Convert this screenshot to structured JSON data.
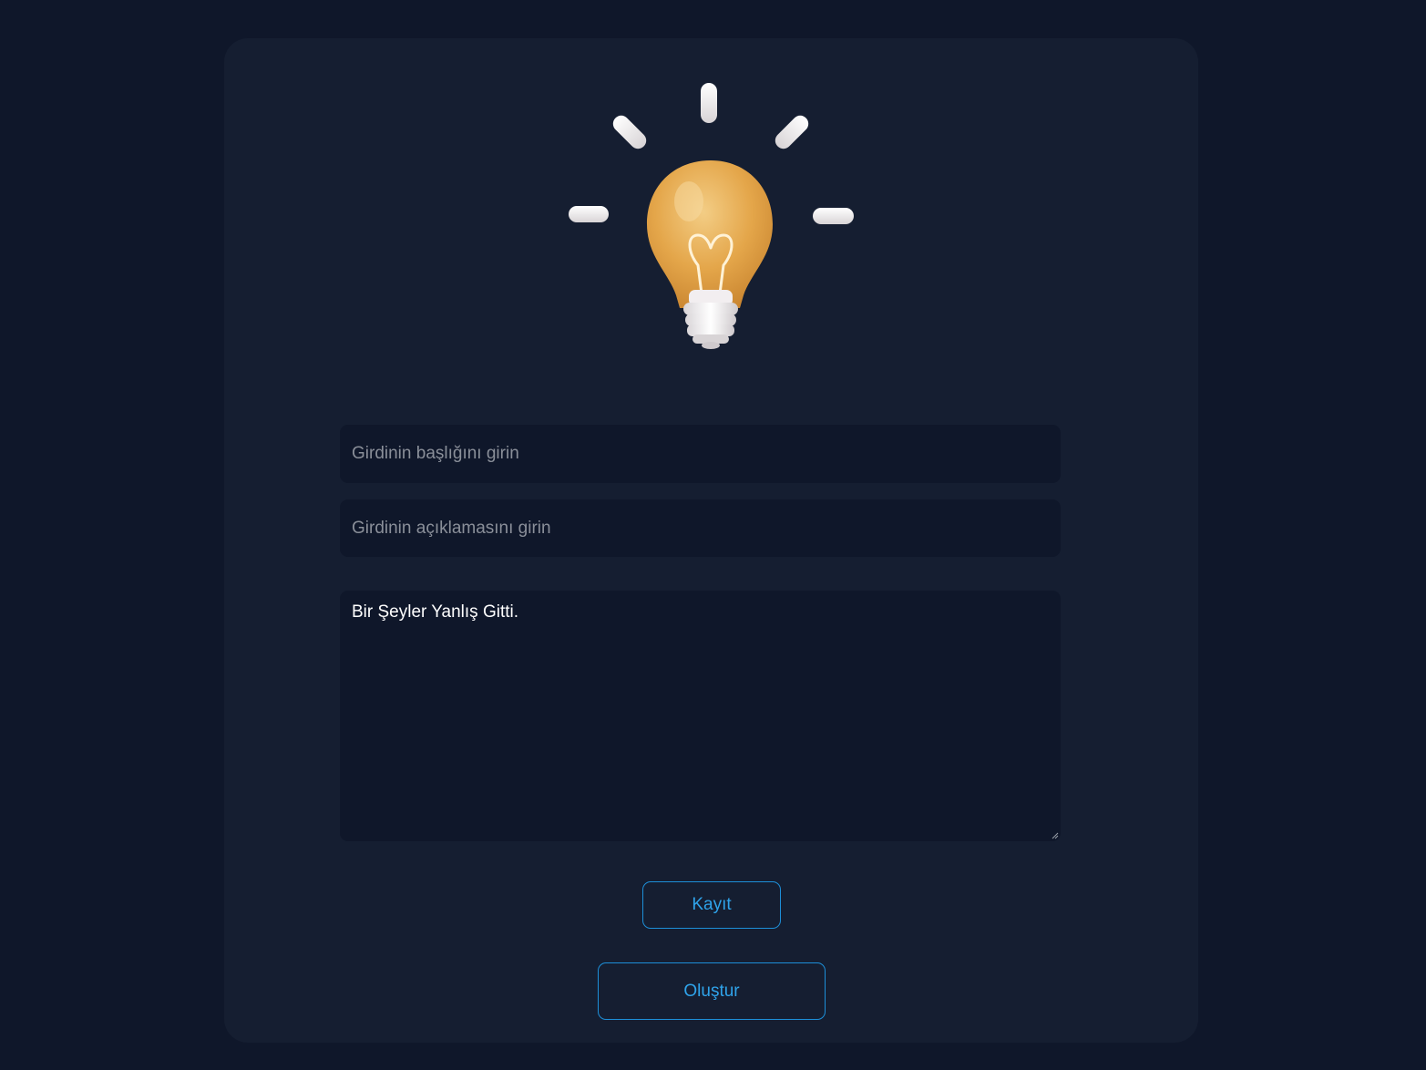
{
  "form": {
    "title_placeholder": "Girdinin başlığını girin",
    "description_placeholder": "Girdinin açıklamasını girin",
    "content_text": "Bir Şeyler Yanlış Gitti."
  },
  "buttons": {
    "save_label": "Kayıt",
    "create_label": "Oluştur"
  },
  "colors": {
    "page_bg": "#0f172a",
    "card_bg": "#151e31",
    "field_bg": "#0f172a",
    "accent": "#1d8fd8",
    "bulb": "#e6a94c"
  },
  "icons": {
    "hero": "lightbulb-icon"
  }
}
